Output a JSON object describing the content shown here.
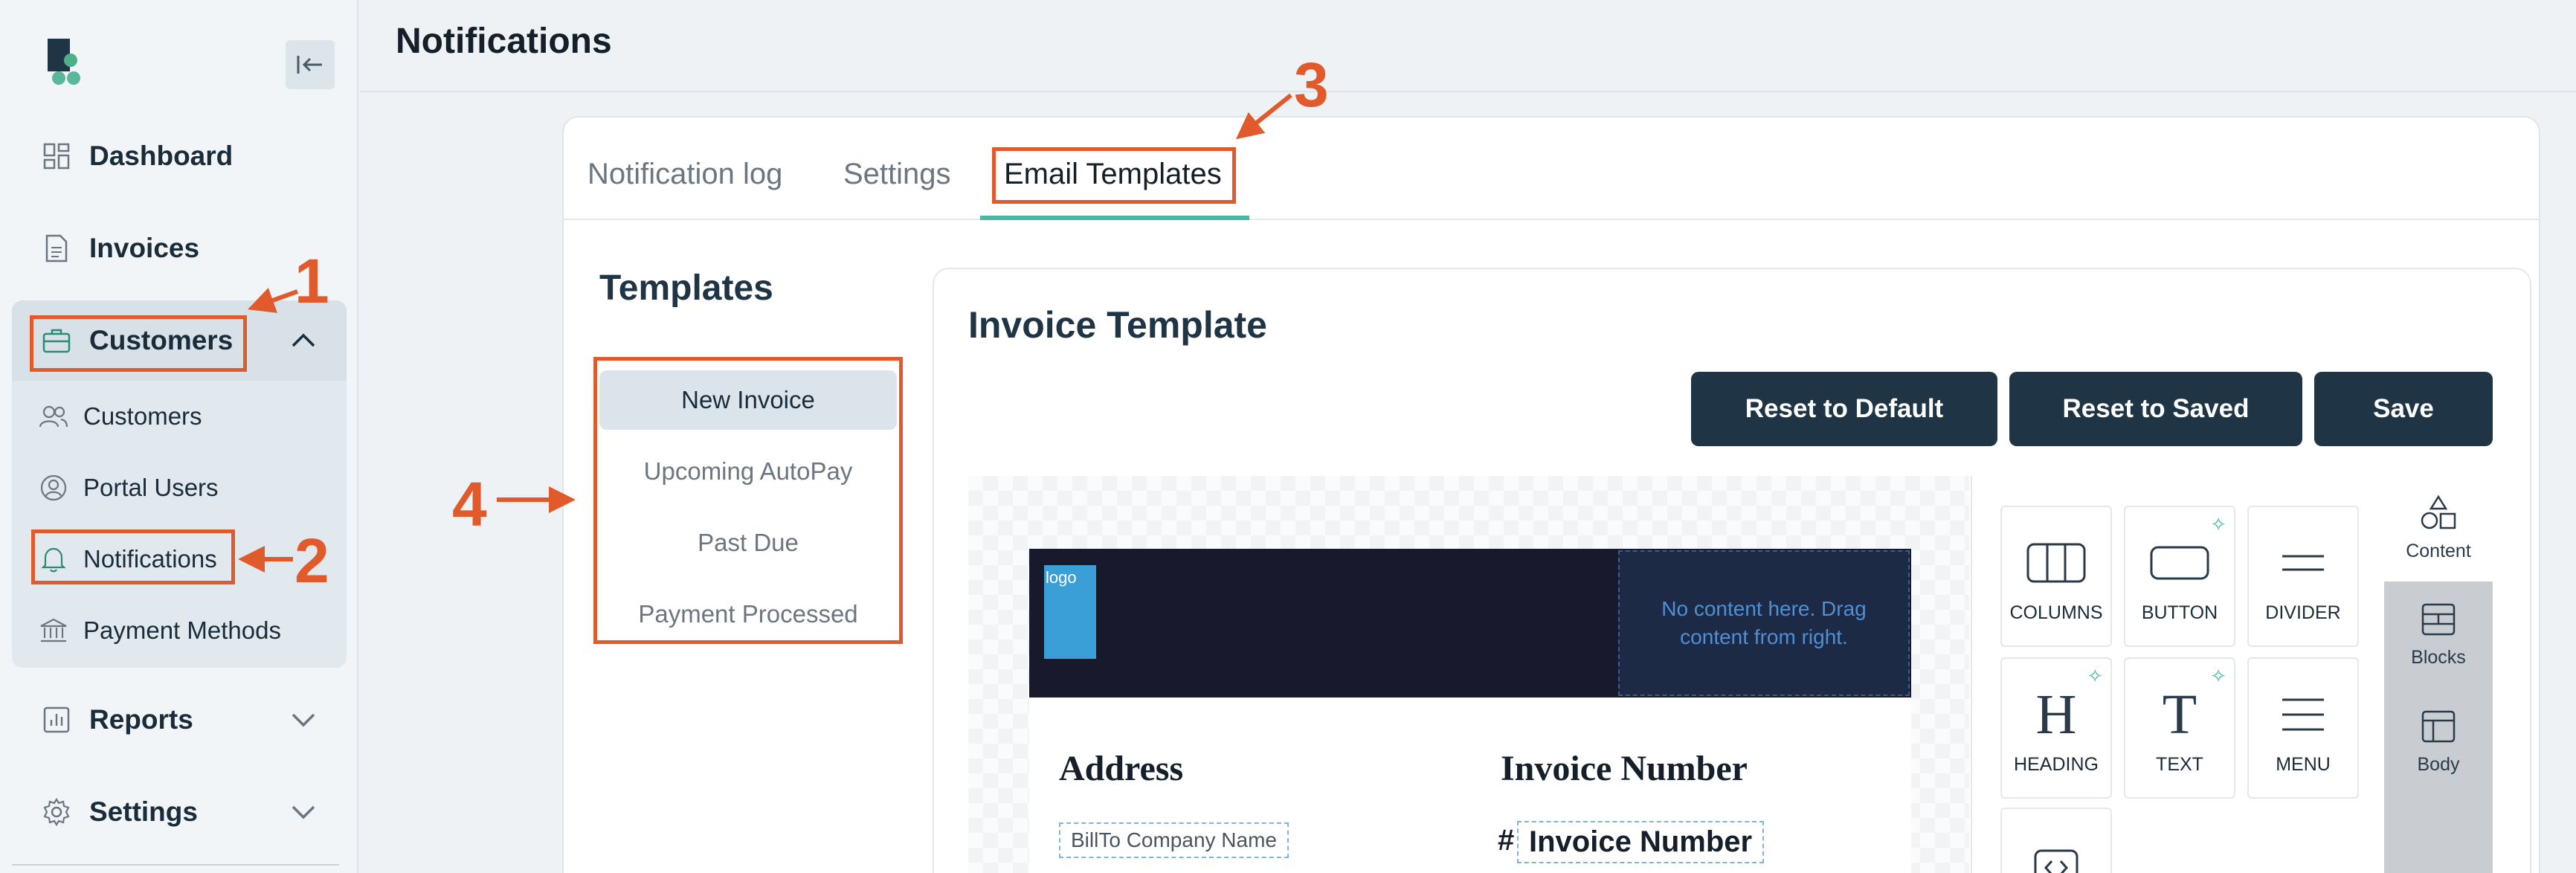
{
  "page": {
    "title": "Notifications"
  },
  "sidebar": {
    "items": [
      {
        "label": "Dashboard",
        "icon": "dashboard-icon"
      },
      {
        "label": "Invoices",
        "icon": "invoice-icon"
      },
      {
        "label": "Customers",
        "icon": "briefcase-icon",
        "expanded": true
      },
      {
        "label": "Reports",
        "icon": "chart-icon"
      },
      {
        "label": "Settings",
        "icon": "gear-icon"
      }
    ],
    "customers_sub": [
      {
        "label": "Customers",
        "icon": "users-icon"
      },
      {
        "label": "Portal Users",
        "icon": "user-circle-icon"
      },
      {
        "label": "Notifications",
        "icon": "bell-icon",
        "active": true
      },
      {
        "label": "Payment Methods",
        "icon": "bank-icon"
      }
    ]
  },
  "tabs": [
    {
      "label": "Notification log"
    },
    {
      "label": "Settings"
    },
    {
      "label": "Email Templates",
      "active": true
    }
  ],
  "templates": {
    "heading": "Templates",
    "items": [
      "New Invoice",
      "Upcoming AutoPay",
      "Past Due",
      "Payment Processed"
    ],
    "selected": "New Invoice"
  },
  "editor": {
    "title": "Invoice Template",
    "buttons": {
      "reset_default": "Reset to Default",
      "reset_saved": "Reset to Saved",
      "save": "Save"
    },
    "logo_alt": "logo",
    "drop_zone_text": "No content here. Drag content from right.",
    "address_heading": "Address",
    "invoice_heading": "Invoice Number",
    "billto_field": "BillTo Company Name",
    "hash": "#",
    "invoice_number_field": "Invoice Number"
  },
  "tools": [
    "COLUMNS",
    "BUTTON",
    "DIVIDER",
    "HEADING",
    "TEXT",
    "MENU"
  ],
  "side_tabs": [
    "Content",
    "Blocks",
    "Body"
  ],
  "annotations": [
    "1",
    "2",
    "3",
    "4"
  ],
  "colors": {
    "accent": "#e05a2b",
    "primary": "#1f3444",
    "tab_underline": "#4db8a0"
  }
}
